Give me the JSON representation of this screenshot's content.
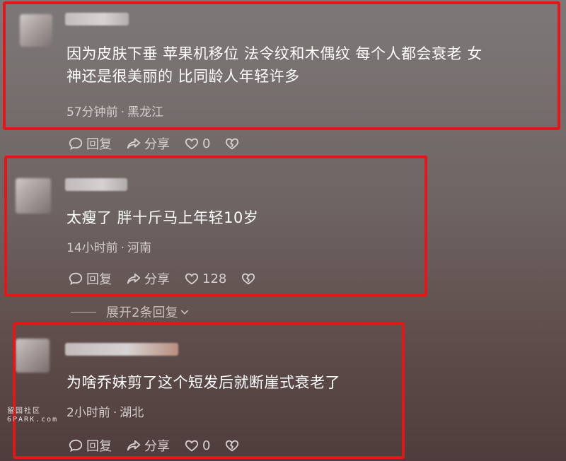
{
  "comments": [
    {
      "text": "因为皮肤下垂 苹果机移位 法令纹和木偶纹 每个人都会衰老 女\n神还是很美丽的 比同龄人年轻许多",
      "time": "57分钟前",
      "location": "黑龙江",
      "reply_label": "回复",
      "share_label": "分享",
      "likes": "0"
    },
    {
      "text": "太瘦了 胖十斤马上年轻10岁",
      "time": "14小时前",
      "location": "河南",
      "reply_label": "回复",
      "share_label": "分享",
      "likes": "128"
    },
    {
      "text": "为啥乔妹剪了这个短发后就断崖式衰老了",
      "time": "2小时前",
      "location": "湖北",
      "reply_label": "回复",
      "share_label": "分享",
      "likes": "0"
    }
  ],
  "expand_replies": "展开2条回复",
  "separator": "·",
  "watermark": {
    "line1": "留园社区",
    "line2": "6PARK.com"
  },
  "colors": {
    "highlight_frame": "#e5161a"
  },
  "icons": [
    "comment-bubble-icon",
    "share-arrow-icon",
    "heart-icon",
    "broken-heart-icon",
    "chevron-down-icon"
  ]
}
